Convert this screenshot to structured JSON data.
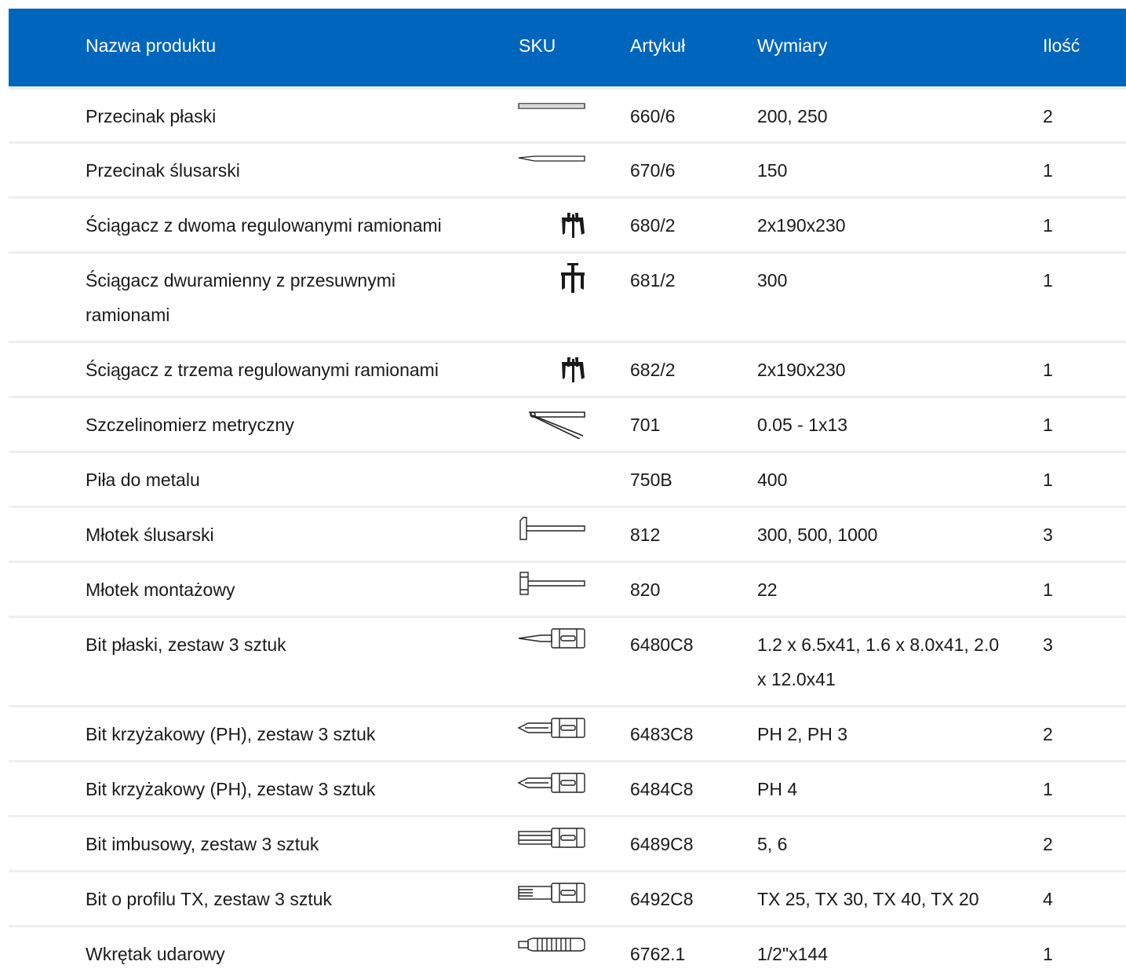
{
  "header": {
    "name": "Nazwa produktu",
    "sku": "SKU",
    "article": "Artykuł",
    "dimensions": "Wymiary",
    "qty": "Ilość"
  },
  "rows": [
    {
      "name": "Przecinak płaski",
      "icon": "flat-chisel-icon",
      "article": "660/6",
      "dimensions": "200, 250",
      "qty": "2"
    },
    {
      "name": "Przecinak ślusarski",
      "icon": "cross-cut-chisel-icon",
      "article": "670/6",
      "dimensions": "150",
      "qty": "1"
    },
    {
      "name": "Ściągacz z dwoma regulowanymi ramionami",
      "icon": "two-arm-puller-icon",
      "article": "680/2",
      "dimensions": "2x190x230",
      "qty": "1"
    },
    {
      "name": "Ściągacz dwuramienny z przesuwnymi ramionami",
      "icon": "sliding-arm-puller-icon",
      "article": "681/2",
      "dimensions": "300",
      "qty": "1"
    },
    {
      "name": "Ściągacz z trzema regulowanymi ramionami",
      "icon": "three-arm-puller-icon",
      "article": "682/2",
      "dimensions": "2x190x230",
      "qty": "1"
    },
    {
      "name": "Szczelinomierz metryczny",
      "icon": "feeler-gauge-icon",
      "article": "701",
      "dimensions": "0.05 - 1x13",
      "qty": "1"
    },
    {
      "name": "Piła do metalu",
      "icon": "",
      "article": "750B",
      "dimensions": "400",
      "qty": "1"
    },
    {
      "name": "Młotek ślusarski",
      "icon": "locksmith-hammer-icon",
      "article": "812",
      "dimensions": "300, 500, 1000",
      "qty": "3"
    },
    {
      "name": "Młotek montażowy",
      "icon": "assembly-hammer-icon",
      "article": "820",
      "dimensions": "22",
      "qty": "1"
    },
    {
      "name": "Bit płaski, zestaw 3 sztuk",
      "icon": "flat-bit-icon",
      "article": "6480C8",
      "dimensions": "1.2 x 6.5x41, 1.6 x 8.0x41, 2.0 x 12.0x41",
      "qty": "3"
    },
    {
      "name": "Bit krzyżakowy (PH), zestaw 3 sztuk",
      "icon": "phillips-bit-icon",
      "article": "6483C8",
      "dimensions": "PH 2, PH 3",
      "qty": "2"
    },
    {
      "name": "Bit krzyżakowy (PH), zestaw 3 sztuk",
      "icon": "phillips-bit-icon",
      "article": "6484C8",
      "dimensions": "PH 4",
      "qty": "1"
    },
    {
      "name": "Bit imbusowy, zestaw 3 sztuk",
      "icon": "hex-bit-icon",
      "article": "6489C8",
      "dimensions": "5, 6",
      "qty": "2"
    },
    {
      "name": "Bit o profilu TX, zestaw 3 sztuk",
      "icon": "torx-bit-icon",
      "article": "6492C8",
      "dimensions": "TX 25, TX 30, TX 40, TX 20",
      "qty": "4"
    },
    {
      "name": "Wkrętak udarowy",
      "icon": "impact-driver-icon",
      "article": "6762.1",
      "dimensions": "1/2\"x144",
      "qty": "1"
    }
  ]
}
